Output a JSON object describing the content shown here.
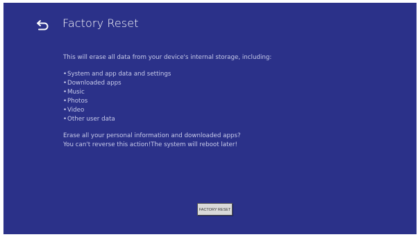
{
  "header": {
    "back_icon": "back-arrow-icon",
    "title": "Factory Reset"
  },
  "content": {
    "intro": "This will erase all data from your device's internal storage, including:",
    "items": [
      "System and app data and settings",
      "Downloaded apps",
      "Music",
      "Photos",
      "Video",
      "Other user data"
    ],
    "warning_line1": "Erase all your personal information and downloaded apps?",
    "warning_line2": "You can't reverse this action!The system will reboot later!"
  },
  "actions": {
    "reset_label": "FACTORY RESET"
  },
  "colors": {
    "background": "#2b3189",
    "text": "#c8cbea",
    "title": "#ffffff",
    "button": "#d9d9d9"
  }
}
